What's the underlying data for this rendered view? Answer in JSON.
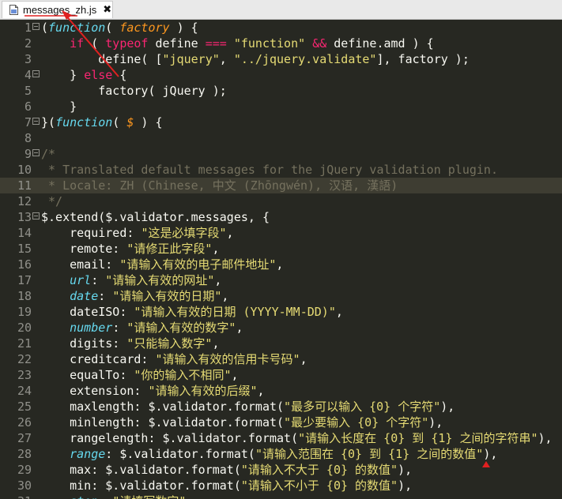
{
  "tab": {
    "title": "messages_zh.js",
    "close": "✖",
    "icon": "js-file-icon"
  },
  "lines": [
    {
      "num": "1",
      "fold": "open",
      "parts": [
        [
          "p",
          "(function( "
        ],
        [
          "p",
          "factory"
        ],
        [
          "p",
          " ) {"
        ]
      ]
    },
    {
      "num": "2",
      "fold": "",
      "parts": [
        [
          "t",
          "    "
        ],
        [
          "k",
          "if"
        ],
        [
          "t",
          " ( "
        ],
        [
          "k",
          "typeof"
        ],
        [
          "t",
          " define "
        ],
        [
          "k",
          "==="
        ],
        [
          "t",
          " "
        ],
        [
          "s",
          "\"function\""
        ],
        [
          "t",
          " "
        ],
        [
          "k",
          "&&"
        ],
        [
          "t",
          " define.amd ) {"
        ]
      ]
    },
    {
      "num": "3",
      "fold": "",
      "parts": [
        [
          "t",
          "        define( ["
        ],
        [
          "s",
          "\"jquery\""
        ],
        [
          "t",
          ", "
        ],
        [
          "s",
          "\"../jquery.validate\""
        ],
        [
          "t",
          "], factory );"
        ]
      ]
    },
    {
      "num": "4",
      "fold": "open",
      "parts": [
        [
          "t",
          "    } "
        ],
        [
          "k",
          "else"
        ],
        [
          "t",
          " {"
        ]
      ]
    },
    {
      "num": "5",
      "fold": "",
      "parts": [
        [
          "t",
          "        factory( jQuery );"
        ]
      ]
    },
    {
      "num": "6",
      "fold": "",
      "parts": [
        [
          "t",
          "    }"
        ]
      ]
    },
    {
      "num": "7",
      "fold": "open",
      "parts": [
        [
          "t",
          "}("
        ],
        [
          "st",
          "function"
        ],
        [
          "t",
          "( "
        ],
        [
          "p",
          "$"
        ],
        [
          "t",
          " ) {"
        ]
      ]
    },
    {
      "num": "8",
      "fold": "",
      "parts": [
        [
          "t",
          ""
        ]
      ]
    },
    {
      "num": "9",
      "fold": "open",
      "parts": [
        [
          "c",
          "/*"
        ]
      ]
    },
    {
      "num": "10",
      "fold": "",
      "parts": [
        [
          "c",
          " * Translated default messages for the jQuery validation plugin."
        ]
      ]
    },
    {
      "num": "11",
      "fold": "",
      "hl": true,
      "parts": [
        [
          "c",
          " * Locale: ZH (Chinese, 中文 (Zhōngwén), 汉语, 漢語)"
        ]
      ]
    },
    {
      "num": "12",
      "fold": "",
      "parts": [
        [
          "c",
          " */"
        ]
      ]
    },
    {
      "num": "13",
      "fold": "open",
      "parts": [
        [
          "t",
          "$.extend($.validator.messages, {"
        ]
      ]
    },
    {
      "num": "14",
      "fold": "",
      "parts": [
        [
          "t",
          "    required: "
        ],
        [
          "s",
          "\"这是必填字段\""
        ],
        [
          "t",
          ","
        ]
      ]
    },
    {
      "num": "15",
      "fold": "",
      "parts": [
        [
          "t",
          "    remote: "
        ],
        [
          "s",
          "\"请修正此字段\""
        ],
        [
          "t",
          ","
        ]
      ]
    },
    {
      "num": "16",
      "fold": "",
      "parts": [
        [
          "t",
          "    email: "
        ],
        [
          "s",
          "\"请输入有效的电子邮件地址\""
        ],
        [
          "t",
          ","
        ]
      ]
    },
    {
      "num": "17",
      "fold": "",
      "parts": [
        [
          "t",
          "    "
        ],
        [
          "st",
          "url"
        ],
        [
          "t",
          ": "
        ],
        [
          "s",
          "\"请输入有效的网址\""
        ],
        [
          "t",
          ","
        ]
      ]
    },
    {
      "num": "18",
      "fold": "",
      "parts": [
        [
          "t",
          "    "
        ],
        [
          "st",
          "date"
        ],
        [
          "t",
          ": "
        ],
        [
          "s",
          "\"请输入有效的日期\""
        ],
        [
          "t",
          ","
        ]
      ]
    },
    {
      "num": "19",
      "fold": "",
      "parts": [
        [
          "t",
          "    dateISO: "
        ],
        [
          "s",
          "\"请输入有效的日期 (YYYY-MM-DD)\""
        ],
        [
          "t",
          ","
        ]
      ]
    },
    {
      "num": "20",
      "fold": "",
      "parts": [
        [
          "t",
          "    "
        ],
        [
          "st",
          "number"
        ],
        [
          "t",
          ": "
        ],
        [
          "s",
          "\"请输入有效的数字\""
        ],
        [
          "t",
          ","
        ]
      ]
    },
    {
      "num": "21",
      "fold": "",
      "parts": [
        [
          "t",
          "    digits: "
        ],
        [
          "s",
          "\"只能输入数字\""
        ],
        [
          "t",
          ","
        ]
      ]
    },
    {
      "num": "22",
      "fold": "",
      "parts": [
        [
          "t",
          "    creditcard: "
        ],
        [
          "s",
          "\"请输入有效的信用卡号码\""
        ],
        [
          "t",
          ","
        ]
      ]
    },
    {
      "num": "23",
      "fold": "",
      "parts": [
        [
          "t",
          "    equalTo: "
        ],
        [
          "s",
          "\"你的输入不相同\""
        ],
        [
          "t",
          ","
        ]
      ]
    },
    {
      "num": "24",
      "fold": "",
      "parts": [
        [
          "t",
          "    extension: "
        ],
        [
          "s",
          "\"请输入有效的后缀\""
        ],
        [
          "t",
          ","
        ]
      ]
    },
    {
      "num": "25",
      "fold": "",
      "parts": [
        [
          "t",
          "    maxlength: $.validator.format("
        ],
        [
          "s",
          "\"最多可以输入 {0} 个字符\""
        ],
        [
          "t",
          "),"
        ]
      ]
    },
    {
      "num": "26",
      "fold": "",
      "parts": [
        [
          "t",
          "    minlength: $.validator.format("
        ],
        [
          "s",
          "\"最少要输入 {0} 个字符\""
        ],
        [
          "t",
          "),"
        ]
      ]
    },
    {
      "num": "27",
      "fold": "",
      "parts": [
        [
          "t",
          "    rangelength: $.validator.format("
        ],
        [
          "s",
          "\"请输入长度在 {0} 到 {1} 之间的字符串\""
        ],
        [
          "t",
          "),"
        ]
      ]
    },
    {
      "num": "28",
      "fold": "",
      "parts": [
        [
          "t",
          "    "
        ],
        [
          "st",
          "range"
        ],
        [
          "t",
          ": $.validator.format("
        ],
        [
          "s",
          "\"请输入范围在 {0} 到 {1} 之间的数值\""
        ],
        [
          "t",
          "),"
        ]
      ]
    },
    {
      "num": "29",
      "fold": "",
      "parts": [
        [
          "t",
          "    max: $.validator.format("
        ],
        [
          "s",
          "\"请输入不大于 {0} 的数值\""
        ],
        [
          "t",
          "),"
        ]
      ]
    },
    {
      "num": "30",
      "fold": "",
      "parts": [
        [
          "t",
          "    min: $.validator.format("
        ],
        [
          "s",
          "\"请输入不小于 {0} 的数值\""
        ],
        [
          "t",
          "),"
        ]
      ]
    },
    {
      "num": "31",
      "fold": "",
      "parts": [
        [
          "t",
          "    "
        ],
        [
          "st",
          "step"
        ],
        [
          "t",
          ": "
        ],
        [
          "s",
          "\"请填写数字\""
        ]
      ]
    }
  ],
  "colors": {
    "background": "#272822",
    "keyword": "#f92672",
    "string": "#e6db74",
    "comment": "#75715e",
    "param": "#fd971f",
    "storage": "#66d9ef",
    "annotation": "#e02020"
  }
}
